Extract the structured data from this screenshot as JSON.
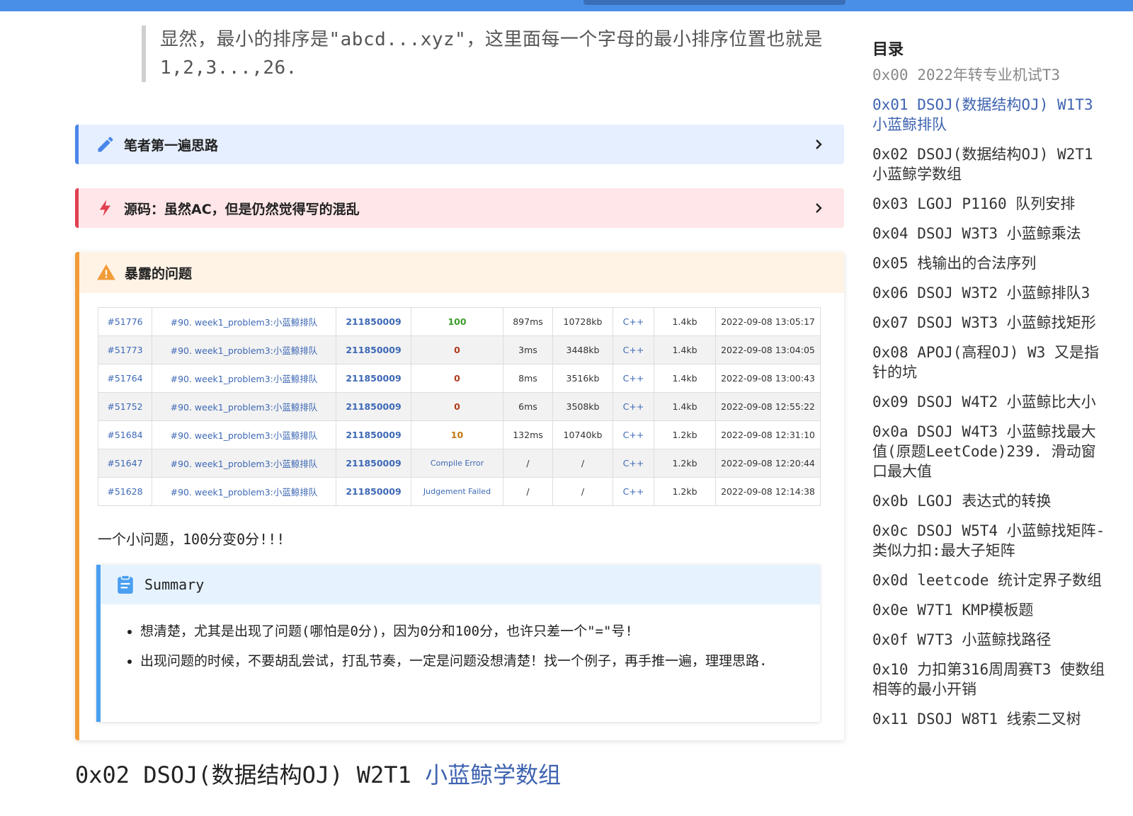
{
  "quote": {
    "line1": "显然，最小的排序是\"abcd...xyz\"，这里面每一个字母的最小排序位置也就是",
    "line2": "1,2,3...,26."
  },
  "admonitions": {
    "first_idea": "笔者第一遍思路",
    "source": "源码：虽然AC，但是仍然觉得写的混乱",
    "problems": "暴露的问题"
  },
  "submissions": [
    {
      "id": "#51776",
      "problem": "#90. week1_problem3:小蓝鲸排队",
      "user": "211850009",
      "score": "100",
      "time": "897ms",
      "memory": "10728kb",
      "lang": "C++",
      "size": "1.4kb",
      "date": "2022-09-08 13:05:17"
    },
    {
      "id": "#51773",
      "problem": "#90. week1_problem3:小蓝鲸排队",
      "user": "211850009",
      "score": "0",
      "time": "3ms",
      "memory": "3448kb",
      "lang": "C++",
      "size": "1.4kb",
      "date": "2022-09-08 13:04:05"
    },
    {
      "id": "#51764",
      "problem": "#90. week1_problem3:小蓝鲸排队",
      "user": "211850009",
      "score": "0",
      "time": "8ms",
      "memory": "3516kb",
      "lang": "C++",
      "size": "1.4kb",
      "date": "2022-09-08 13:00:43"
    },
    {
      "id": "#51752",
      "problem": "#90. week1_problem3:小蓝鲸排队",
      "user": "211850009",
      "score": "0",
      "time": "6ms",
      "memory": "3508kb",
      "lang": "C++",
      "size": "1.4kb",
      "date": "2022-09-08 12:55:22"
    },
    {
      "id": "#51684",
      "problem": "#90. week1_problem3:小蓝鲸排队",
      "user": "211850009",
      "score": "10",
      "time": "132ms",
      "memory": "10740kb",
      "lang": "C++",
      "size": "1.2kb",
      "date": "2022-09-08 12:31:10"
    },
    {
      "id": "#51647",
      "problem": "#90. week1_problem3:小蓝鲸排队",
      "user": "211850009",
      "score": "Compile Error",
      "time": "/",
      "memory": "/",
      "lang": "C++",
      "size": "1.2kb",
      "date": "2022-09-08 12:20:44"
    },
    {
      "id": "#51628",
      "problem": "#90. week1_problem3:小蓝鲸排队",
      "user": "211850009",
      "score": "Judgement Failed",
      "time": "/",
      "memory": "/",
      "lang": "C++",
      "size": "1.2kb",
      "date": "2022-09-08 12:14:38"
    }
  ],
  "note": "一个小问题，100分变0分!!!",
  "summary": {
    "title": "Summary",
    "items": [
      "想清楚，尤其是出现了问题(哪怕是0分)，因为0分和100分，也许只差一个\"=\"号!",
      "出现问题的时候，不要胡乱尝试，打乱节奏，一定是问题没想清楚！找一个例子，再手推一遍，理理思路."
    ]
  },
  "heading": {
    "prefix": "0x02 DSOJ(数据结构OJ) W2T1 ",
    "accent": "小蓝鲸学数组"
  },
  "toc": {
    "title": "目录",
    "items": [
      "0x00 2022年转专业机试T3",
      "0x01 DSOJ(数据结构OJ) W1T3 小蓝鲸排队",
      "0x02 DSOJ(数据结构OJ) W2T1 小蓝鲸学数组",
      "0x03 LGOJ P1160 队列安排",
      "0x04 DSOJ W3T3 小蓝鲸乘法",
      "0x05 栈输出的合法序列",
      "0x06 DSOJ W3T2 小蓝鲸排队3",
      "0x07 DSOJ W3T3 小蓝鲸找矩形",
      "0x08 APOJ(高程OJ) W3 又是指针的坑",
      "0x09 DSOJ W4T2 小蓝鲸比大小",
      "0x0a DSOJ W4T3 小蓝鲸找最大值(原题LeetCode)239. 滑动窗口最大值",
      "0x0b LGOJ 表达式的转换",
      "0x0c DSOJ W5T4 小蓝鲸找矩阵-类似力扣:最大子矩阵",
      "0x0d leetcode 统计定界子数组",
      "0x0e W7T1 KMP模板题",
      "0x0f W7T3 小蓝鲸找路径",
      "0x10 力扣第316周周赛T3 使数组相等的最小开销",
      "0x11 DSOJ W8T1 线索二叉树"
    ]
  },
  "colors": {
    "accent_blue": "#3e63b0",
    "topbar": "#4a8fe7",
    "admonition_blue": "#4a86e8",
    "admonition_red": "#e04050",
    "admonition_orange": "#f29c38",
    "summary_blue": "#4a9ff0"
  },
  "icons": {
    "first_idea": "pencil-icon",
    "source": "lightning-icon",
    "problems": "warning-icon",
    "summary": "clipboard-icon",
    "expand": "chevron-right-icon"
  }
}
